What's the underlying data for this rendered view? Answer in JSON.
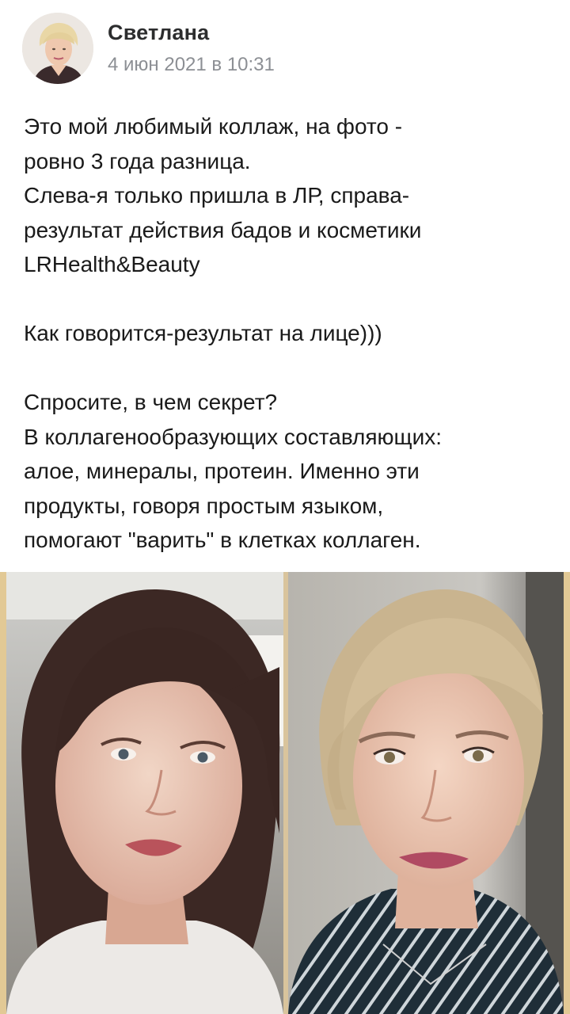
{
  "post": {
    "author": "Светлана",
    "date": "4 июн 2021 в 10:31",
    "text": {
      "p1": "Это мой любимый коллаж, на фото -\nровно 3 года разница.\nСлева-я только пришла в ЛР, справа-\nрезультат действия бадов и косметики\nLRHealth&Beauty",
      "p2": "Как говорится-результат на лице)))",
      "p3": "Спросите, в чем секрет?\nВ коллагенообразующих составляющих:\nалое, минералы, протеин. Именно эти\nпродукты, говоря простым языком,\nпомогают \"варить\" в клетках коллаген."
    }
  },
  "collage": {
    "left_photo": "before-photo",
    "right_photo": "after-photo"
  }
}
